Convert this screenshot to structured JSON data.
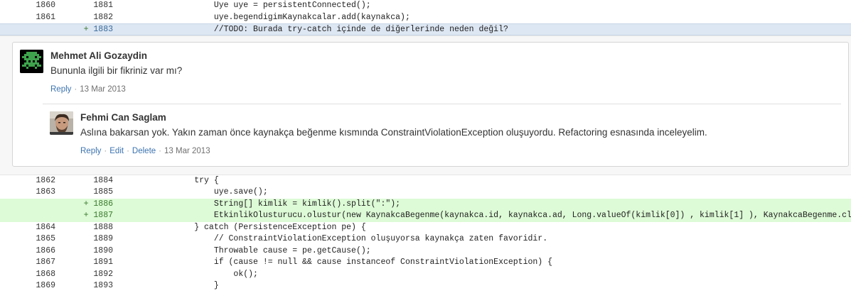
{
  "diff_top": [
    {
      "old": "1860",
      "new": "1881",
      "code": "            Uye uye = persistentConnected();",
      "kind": "context"
    },
    {
      "old": "1861",
      "new": "1882",
      "code": "            uye.begendigimKaynakcalar.add(kaynakca);",
      "kind": "context"
    },
    {
      "old": "",
      "new": "1883",
      "plus": "+ ",
      "code": "            //TODO: Burada try-catch içinde de diğerlerinde neden değil?",
      "kind": "selected"
    }
  ],
  "comments": {
    "first": {
      "author": "Mehmet Ali Gozaydin",
      "text": "Bununla ilgili bir fikriniz var mı?",
      "reply": "Reply",
      "date": "13 Mar 2013"
    },
    "second": {
      "author": "Fehmi Can Saglam",
      "text": "Aslına bakarsan yok. Yakın zaman önce kaynakça beğenme kısmında ConstraintViolationException oluşuyordu. Refactoring esnasında inceleyelim.",
      "reply": "Reply",
      "edit": "Edit",
      "delete": "Delete",
      "date": "13 Mar 2013"
    }
  },
  "diff_bottom": [
    {
      "old": "1862",
      "new": "1884",
      "code": "        try {",
      "kind": "context"
    },
    {
      "old": "1863",
      "new": "1885",
      "code": "            uye.save();",
      "kind": "context"
    },
    {
      "old": "",
      "new": "1886",
      "plus": "+ ",
      "code": "            String[] kimlik = kimlik().split(\":\");",
      "kind": "added"
    },
    {
      "old": "",
      "new": "1887",
      "plus": "+ ",
      "code": "            EtkinlikOlusturucu.olustur(new KaynakcaBegenme(kaynakca.id, kaynakca.ad, Long.valueOf(kimlik[0]) , kimlik[1] ), KaynakcaBegenme.class);",
      "kind": "added"
    },
    {
      "old": "1864",
      "new": "1888",
      "code": "        } catch (PersistenceException pe) {",
      "kind": "context"
    },
    {
      "old": "1865",
      "new": "1889",
      "code": "            // ConstraintViolationException oluşuyorsa kaynakça zaten favoridir.",
      "kind": "context"
    },
    {
      "old": "1866",
      "new": "1890",
      "code": "            Throwable cause = pe.getCause();",
      "kind": "context"
    },
    {
      "old": "1867",
      "new": "1891",
      "code": "            if (cause != null && cause instanceof ConstraintViolationException) {",
      "kind": "context"
    },
    {
      "old": "1868",
      "new": "1892",
      "code": "                ok();",
      "kind": "context"
    },
    {
      "old": "1869",
      "new": "1893",
      "code": "            }",
      "kind": "context"
    }
  ]
}
